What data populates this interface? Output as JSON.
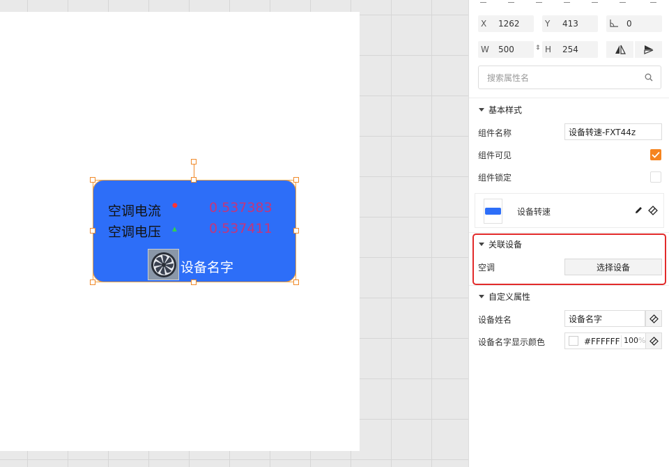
{
  "widget": {
    "row1_label": "空调电流",
    "row1_value": "0.537383",
    "row2_label": "空调电压",
    "row2_value": "0.537411",
    "device_name": "设备名字",
    "dot1": "●",
    "dot2": "▲"
  },
  "transform": {
    "x_label": "X",
    "x_value": "1262",
    "y_label": "Y",
    "y_value": "413",
    "rotation_value": "0",
    "w_label": "W",
    "w_value": "500",
    "h_label": "H",
    "h_value": "254"
  },
  "search": {
    "placeholder": "搜索属性名"
  },
  "basic_style": {
    "title": "基本样式",
    "name_label": "组件名称",
    "name_value": "设备转速-FXT44z",
    "visible_label": "组件可见",
    "visible_checked": true,
    "locked_label": "组件锁定",
    "locked_checked": false
  },
  "component": {
    "name": "设备转速"
  },
  "linked_device": {
    "title": "关联设备",
    "device_label": "空调",
    "select_button": "选择设备"
  },
  "custom_props": {
    "title": "自定义属性",
    "device_name_label": "设备姓名",
    "device_name_value": "设备名字",
    "color_label": "设备名字显示颜色",
    "color_hex": "#FFFFFF",
    "opacity": "100",
    "opacity_unit": "%"
  },
  "colors": {
    "accent": "#f5841f",
    "widget_bg": "#2d6ef8",
    "value_text": "#c4367a",
    "highlight": "#e22a2a"
  }
}
